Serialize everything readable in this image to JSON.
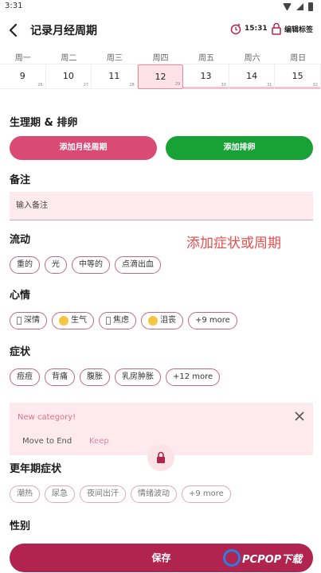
{
  "status_bar": {
    "time": "3:31"
  },
  "app_bar": {
    "title": "记录月经周期",
    "reminder_time": "15:31",
    "edit_tags_label": "编辑标签"
  },
  "calendar": {
    "weekdays": [
      "周一",
      "周二",
      "周三",
      "周四",
      "周五",
      "周六",
      "周日"
    ],
    "days": [
      {
        "date": "9",
        "sub": "26"
      },
      {
        "date": "10",
        "sub": "27"
      },
      {
        "date": "11",
        "sub": "28"
      },
      {
        "date": "12",
        "sub": "29"
      },
      {
        "date": "13",
        "sub": "30"
      },
      {
        "date": "14",
        "sub": "31"
      },
      {
        "date": "15",
        "sub": "32"
      }
    ]
  },
  "sections": {
    "period_ovulation": "生理期 & 排卵",
    "add_period": "添加月经周期",
    "add_ovulation": "添加排卵",
    "notes": "备注",
    "note_placeholder": "输入备注",
    "flow": "流动",
    "hint": "添加症状或周期",
    "mood": "心情",
    "symptoms": "症状",
    "menopause": "更年期症状",
    "gender": "性别"
  },
  "flow_chips": [
    "重的",
    "光",
    "中等的",
    "点滴出血"
  ],
  "mood_chips": [
    "深情",
    "生气",
    "焦虑",
    "沮丧",
    "+9 more"
  ],
  "symptom_chips": [
    "痘痘",
    "背痛",
    "腹胀",
    "乳房肿胀",
    "+12 more"
  ],
  "menopause_chips": [
    "潮热",
    "尿急",
    "夜间出汗",
    "情绪波动",
    "+9 more"
  ],
  "banner": {
    "title": "New category!",
    "move_to_end": "Move to End",
    "keep": "Keep"
  },
  "save_label": "保存",
  "watermark": "PCPOP下载",
  "colors": {
    "primary": "#b0244f",
    "period_button": "#d94a75",
    "ovulation_button": "#18a235",
    "hint_text": "#e84d4d",
    "selected_day_bg": "#fde3e8"
  }
}
